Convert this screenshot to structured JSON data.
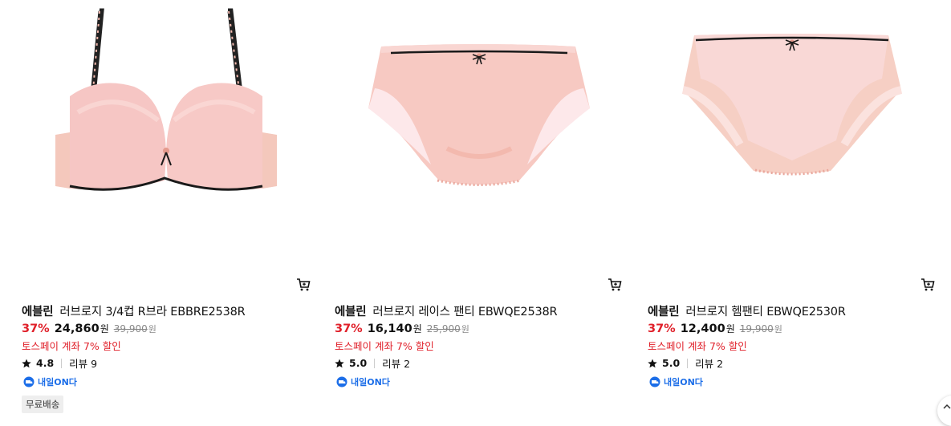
{
  "products": [
    {
      "brand": "에블린",
      "name": "러브로지 3/4컵 R브라 EBBRE2538R",
      "discount": "37%",
      "price": "24,860",
      "currency": "원",
      "original_price": "39,900",
      "original_currency": "원",
      "promo": "토스페이 계좌 7% 할인",
      "rating": "4.8",
      "reviews": "리뷰 9",
      "delivery_badge": "내일ON다",
      "free_shipping": "무료배송",
      "image_icon": "bra-product-image"
    },
    {
      "brand": "에블린",
      "name": "러브로지 레이스 팬티 EBWQE2538R",
      "discount": "37%",
      "price": "16,140",
      "currency": "원",
      "original_price": "25,900",
      "original_currency": "원",
      "promo": "토스페이 계좌 7% 할인",
      "rating": "5.0",
      "reviews": "리뷰 2",
      "delivery_badge": "내일ON다",
      "image_icon": "lace-panty-product-image"
    },
    {
      "brand": "에블린",
      "name": "러브로지 헴팬티 EBWQE2530R",
      "discount": "37%",
      "price": "12,400",
      "currency": "원",
      "original_price": "19,900",
      "original_currency": "원",
      "promo": "토스페이 계좌 7% 할인",
      "rating": "5.0",
      "reviews": "리뷰 2",
      "delivery_badge": "내일ON다",
      "image_icon": "hem-panty-product-image"
    }
  ],
  "colors": {
    "discount_red": "#e0202a",
    "delivery_blue": "#1c6ee8",
    "product_pink": "#f6c6c0",
    "trim_black": "#1a1a1a"
  }
}
